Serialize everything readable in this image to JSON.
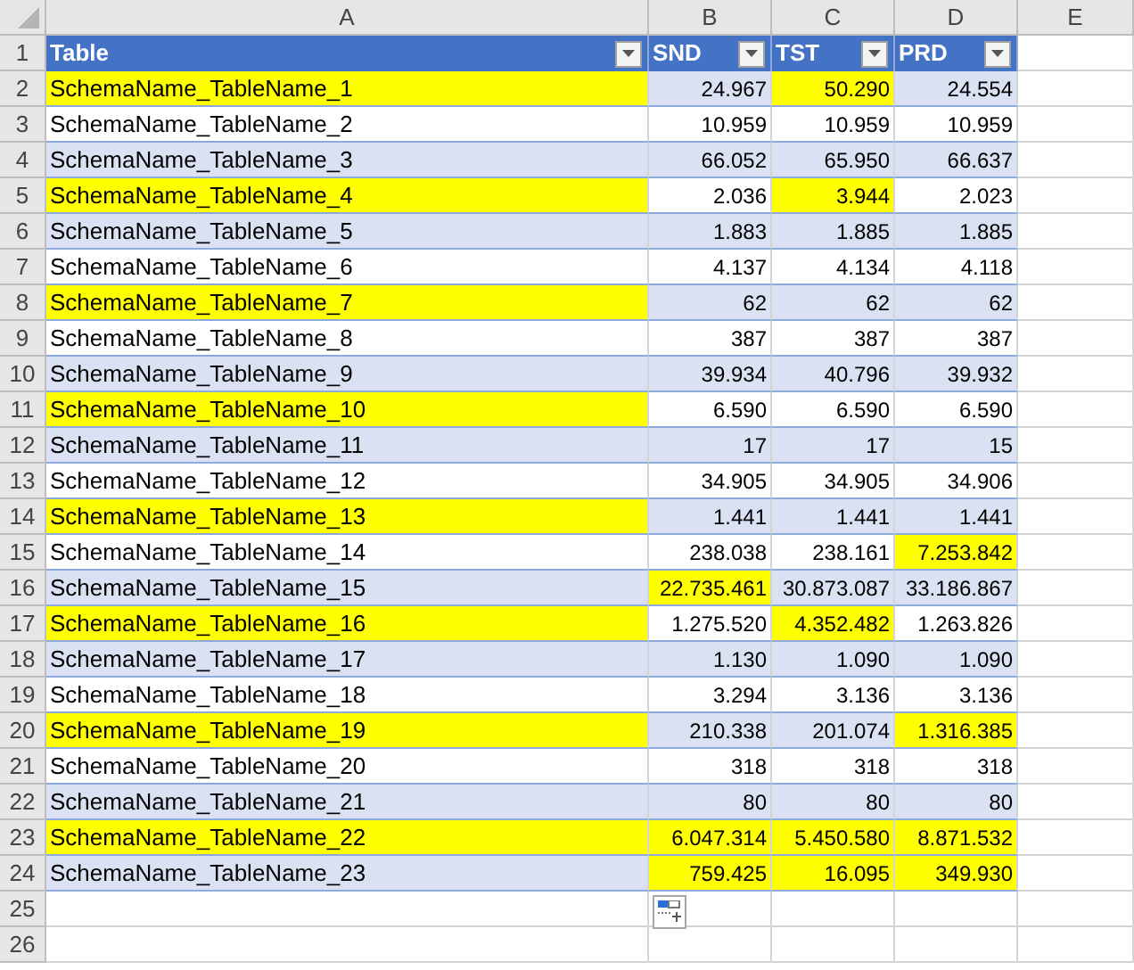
{
  "column_headers": [
    "A",
    "B",
    "C",
    "D",
    "E"
  ],
  "row_numbers": [
    "1",
    "2",
    "3",
    "4",
    "5",
    "6",
    "7",
    "8",
    "9",
    "10",
    "11",
    "12",
    "13",
    "14",
    "15",
    "16",
    "17",
    "18",
    "19",
    "20",
    "21",
    "22",
    "23",
    "24",
    "25",
    "26"
  ],
  "table": {
    "columns": [
      "Table",
      "SND",
      "TST",
      "PRD"
    ],
    "rows": [
      {
        "cells": [
          {
            "text": "SchemaName_TableName_1",
            "highlighted": true
          },
          {
            "text": "24.967",
            "highlighted": false
          },
          {
            "text": "50.290",
            "highlighted": true
          },
          {
            "text": "24.554",
            "highlighted": false
          }
        ]
      },
      {
        "cells": [
          {
            "text": "SchemaName_TableName_2",
            "highlighted": false
          },
          {
            "text": "10.959",
            "highlighted": false
          },
          {
            "text": "10.959",
            "highlighted": false
          },
          {
            "text": "10.959",
            "highlighted": false
          }
        ]
      },
      {
        "cells": [
          {
            "text": "SchemaName_TableName_3",
            "highlighted": false
          },
          {
            "text": "66.052",
            "highlighted": false
          },
          {
            "text": "65.950",
            "highlighted": false
          },
          {
            "text": "66.637",
            "highlighted": false
          }
        ]
      },
      {
        "cells": [
          {
            "text": "SchemaName_TableName_4",
            "highlighted": true
          },
          {
            "text": "2.036",
            "highlighted": false
          },
          {
            "text": "3.944",
            "highlighted": true
          },
          {
            "text": "2.023",
            "highlighted": false
          }
        ]
      },
      {
        "cells": [
          {
            "text": "SchemaName_TableName_5",
            "highlighted": false
          },
          {
            "text": "1.883",
            "highlighted": false
          },
          {
            "text": "1.885",
            "highlighted": false
          },
          {
            "text": "1.885",
            "highlighted": false
          }
        ]
      },
      {
        "cells": [
          {
            "text": "SchemaName_TableName_6",
            "highlighted": false
          },
          {
            "text": "4.137",
            "highlighted": false
          },
          {
            "text": "4.134",
            "highlighted": false
          },
          {
            "text": "4.118",
            "highlighted": false
          }
        ]
      },
      {
        "cells": [
          {
            "text": "SchemaName_TableName_7",
            "highlighted": true
          },
          {
            "text": "62",
            "highlighted": false
          },
          {
            "text": "62",
            "highlighted": false
          },
          {
            "text": "62",
            "highlighted": false
          }
        ]
      },
      {
        "cells": [
          {
            "text": "SchemaName_TableName_8",
            "highlighted": false
          },
          {
            "text": "387",
            "highlighted": false
          },
          {
            "text": "387",
            "highlighted": false
          },
          {
            "text": "387",
            "highlighted": false
          }
        ]
      },
      {
        "cells": [
          {
            "text": "SchemaName_TableName_9",
            "highlighted": false
          },
          {
            "text": "39.934",
            "highlighted": false
          },
          {
            "text": "40.796",
            "highlighted": false
          },
          {
            "text": "39.932",
            "highlighted": false
          }
        ]
      },
      {
        "cells": [
          {
            "text": "SchemaName_TableName_10",
            "highlighted": true
          },
          {
            "text": "6.590",
            "highlighted": false
          },
          {
            "text": "6.590",
            "highlighted": false
          },
          {
            "text": "6.590",
            "highlighted": false
          }
        ]
      },
      {
        "cells": [
          {
            "text": "SchemaName_TableName_11",
            "highlighted": false
          },
          {
            "text": "17",
            "highlighted": false
          },
          {
            "text": "17",
            "highlighted": false
          },
          {
            "text": "15",
            "highlighted": false
          }
        ]
      },
      {
        "cells": [
          {
            "text": "SchemaName_TableName_12",
            "highlighted": false
          },
          {
            "text": "34.905",
            "highlighted": false
          },
          {
            "text": "34.905",
            "highlighted": false
          },
          {
            "text": "34.906",
            "highlighted": false
          }
        ]
      },
      {
        "cells": [
          {
            "text": "SchemaName_TableName_13",
            "highlighted": true
          },
          {
            "text": "1.441",
            "highlighted": false
          },
          {
            "text": "1.441",
            "highlighted": false
          },
          {
            "text": "1.441",
            "highlighted": false
          }
        ]
      },
      {
        "cells": [
          {
            "text": "SchemaName_TableName_14",
            "highlighted": false
          },
          {
            "text": "238.038",
            "highlighted": false
          },
          {
            "text": "238.161",
            "highlighted": false
          },
          {
            "text": "7.253.842",
            "highlighted": true
          }
        ]
      },
      {
        "cells": [
          {
            "text": "SchemaName_TableName_15",
            "highlighted": false
          },
          {
            "text": "22.735.461",
            "highlighted": true
          },
          {
            "text": "30.873.087",
            "highlighted": false
          },
          {
            "text": "33.186.867",
            "highlighted": false
          }
        ]
      },
      {
        "cells": [
          {
            "text": "SchemaName_TableName_16",
            "highlighted": true
          },
          {
            "text": "1.275.520",
            "highlighted": false
          },
          {
            "text": "4.352.482",
            "highlighted": true
          },
          {
            "text": "1.263.826",
            "highlighted": false
          }
        ]
      },
      {
        "cells": [
          {
            "text": "SchemaName_TableName_17",
            "highlighted": false
          },
          {
            "text": "1.130",
            "highlighted": false
          },
          {
            "text": "1.090",
            "highlighted": false
          },
          {
            "text": "1.090",
            "highlighted": false
          }
        ]
      },
      {
        "cells": [
          {
            "text": "SchemaName_TableName_18",
            "highlighted": false
          },
          {
            "text": "3.294",
            "highlighted": false
          },
          {
            "text": "3.136",
            "highlighted": false
          },
          {
            "text": "3.136",
            "highlighted": false
          }
        ]
      },
      {
        "cells": [
          {
            "text": "SchemaName_TableName_19",
            "highlighted": true
          },
          {
            "text": "210.338",
            "highlighted": false
          },
          {
            "text": "201.074",
            "highlighted": false
          },
          {
            "text": "1.316.385",
            "highlighted": true
          }
        ]
      },
      {
        "cells": [
          {
            "text": "SchemaName_TableName_20",
            "highlighted": false
          },
          {
            "text": "318",
            "highlighted": false
          },
          {
            "text": "318",
            "highlighted": false
          },
          {
            "text": "318",
            "highlighted": false
          }
        ]
      },
      {
        "cells": [
          {
            "text": "SchemaName_TableName_21",
            "highlighted": false
          },
          {
            "text": "80",
            "highlighted": false
          },
          {
            "text": "80",
            "highlighted": false
          },
          {
            "text": "80",
            "highlighted": false
          }
        ]
      },
      {
        "cells": [
          {
            "text": "SchemaName_TableName_22",
            "highlighted": true
          },
          {
            "text": "6.047.314",
            "highlighted": true
          },
          {
            "text": "5.450.580",
            "highlighted": true
          },
          {
            "text": "8.871.532",
            "highlighted": true
          }
        ]
      },
      {
        "cells": [
          {
            "text": "SchemaName_TableName_23",
            "highlighted": false
          },
          {
            "text": "759.425",
            "highlighted": true
          },
          {
            "text": "16.095",
            "highlighted": true
          },
          {
            "text": "349.930",
            "highlighted": true
          }
        ]
      }
    ]
  }
}
